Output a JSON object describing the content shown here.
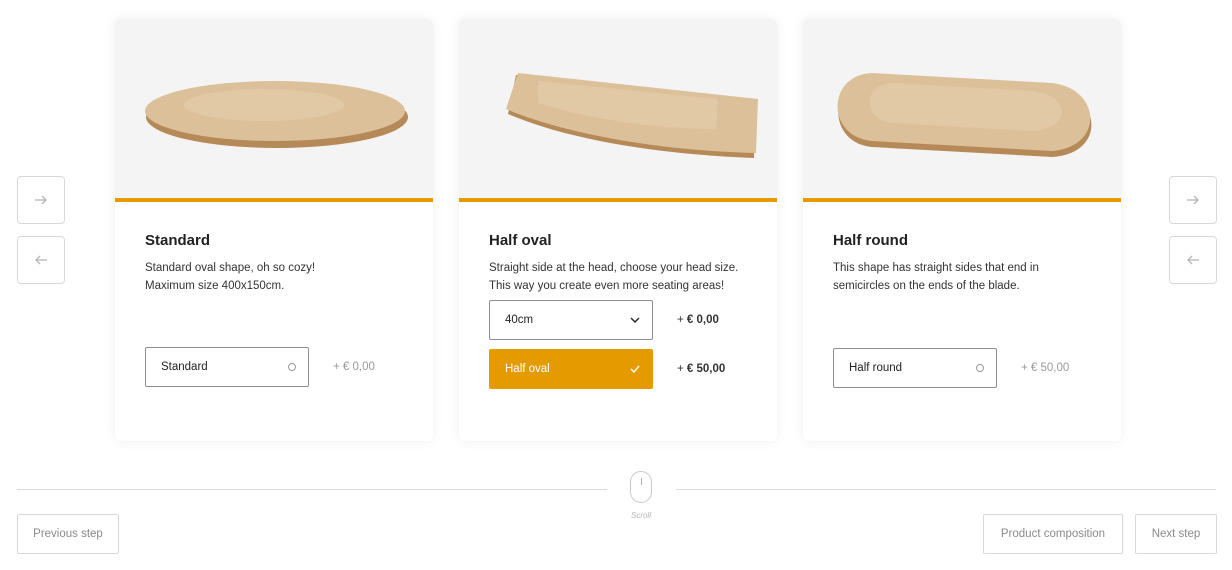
{
  "nav": {
    "left_next_icon": "arrow-right-icon",
    "left_prev_icon": "arrow-left-icon",
    "right_next_icon": "arrow-right-icon",
    "right_prev_icon": "arrow-left-icon"
  },
  "colors": {
    "accent": "#e39b00",
    "card_image_bg": "#f4f4f4",
    "wood": "#d9b98c"
  },
  "cards": [
    {
      "title": "Standard",
      "desc_line1": "Standard oval shape, oh so cozy!",
      "desc_line2": "Maximum size 400x150cm.",
      "image": "oval-table-top",
      "options": [
        {
          "label": "Standard",
          "price_prefix": "+ ",
          "price": "€ 0,00",
          "selected": false
        }
      ]
    },
    {
      "title": "Half oval",
      "desc_line1": "Straight side at the head, choose your head size.",
      "desc_line2": "This way you create even more seating areas!",
      "image": "half-oval-table-top",
      "dropdown": {
        "value": "40cm",
        "price_prefix": "+ ",
        "price": "€ 0,00"
      },
      "options": [
        {
          "label": "Half oval",
          "price_prefix": "+ ",
          "price": "€ 50,00",
          "selected": true
        }
      ]
    },
    {
      "title": "Half round",
      "desc_line1": "This shape has straight sides that end in",
      "desc_line2": "semicircles on the ends of the blade.",
      "image": "half-round-table-top",
      "options": [
        {
          "label": "Half round",
          "price_prefix": "+ ",
          "price": "€ 50,00",
          "selected": false
        }
      ]
    }
  ],
  "scroll": {
    "label": "Scroll"
  },
  "footer": {
    "previous_label": "Previous step",
    "composition_label": "Product composition",
    "next_label": "Next step"
  }
}
